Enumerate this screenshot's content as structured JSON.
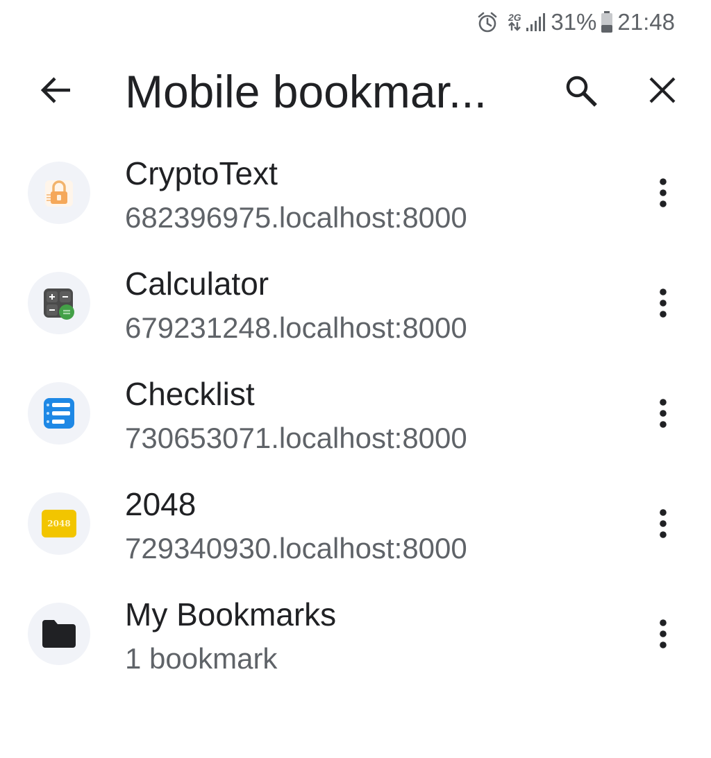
{
  "status_bar": {
    "network": "2G",
    "battery": "31%",
    "time": "21:48",
    "icons": [
      "alarm-icon",
      "network-2g-icon",
      "signal-icon",
      "battery-icon"
    ]
  },
  "app_bar": {
    "title": "Mobile bookmar...",
    "back_icon": "arrow-back-icon",
    "search_icon": "search-icon",
    "close_icon": "close-icon"
  },
  "bookmarks": [
    {
      "title": "CryptoText",
      "subtitle": "682396975.localhost:8000",
      "icon": "cryptotext-favicon"
    },
    {
      "title": "Calculator",
      "subtitle": "679231248.localhost:8000",
      "icon": "calculator-favicon"
    },
    {
      "title": "Checklist",
      "subtitle": "730653071.localhost:8000",
      "icon": "checklist-favicon"
    },
    {
      "title": "2048",
      "subtitle": "729340930.localhost:8000",
      "icon": "game-2048-favicon",
      "icon_text": "2048"
    },
    {
      "title": "My Bookmarks",
      "subtitle": "1 bookmark",
      "icon": "folder-icon"
    }
  ],
  "colors": {
    "text_primary": "#202124",
    "text_secondary": "#5f6368",
    "avatar_bg": "#f1f3f8",
    "checklist_blue": "#1e88e5",
    "game_yellow": "#f2c500",
    "calculator_green": "#43a047"
  }
}
